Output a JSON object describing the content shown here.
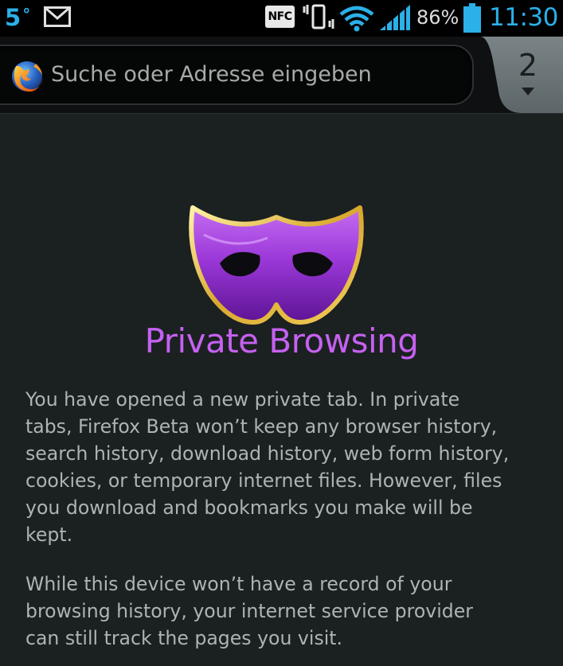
{
  "status_bar": {
    "temperature": "5",
    "degree_symbol": "°",
    "nfc_label": "NFC",
    "battery_percent": "86%",
    "time": "11:30",
    "icons": [
      "gmail-icon",
      "nfc-icon",
      "vibrate-icon",
      "wifi-icon",
      "signal-icon",
      "battery-icon"
    ],
    "accent_color": "#2bb0e8"
  },
  "toolbar": {
    "url_placeholder": "Suche oder Adresse eingeben",
    "tab_count": "2",
    "icons": [
      "firefox-icon",
      "chevron-down-icon"
    ]
  },
  "private_browsing": {
    "icon": "purple-mask-icon",
    "title": "Private Browsing",
    "title_color": "#c561f0",
    "paragraph_1": "You have opened a new private tab. In private\ntabs, Firefox Beta won’t keep any browser history,\nsearch history, download history, web form history,\ncookies, or temporary internet files. However, files\nyou download and bookmarks you make will be\nkept.",
    "paragraph_2": "While this device won’t have a record of your\nbrowsing history, your internet service provider\ncan still track the pages you visit."
  }
}
